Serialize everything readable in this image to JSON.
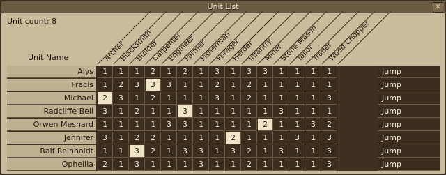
{
  "window": {
    "title": "Unit List",
    "close_label": "x"
  },
  "unit_count_label": "Unit count: 8",
  "unit_name_header": "Unit Name",
  "professions": [
    "Archer",
    "Blacksmith",
    "Builder",
    "Carpenter",
    "Engineer",
    "Farmer",
    "Fisherman",
    "Forager",
    "Herder",
    "Infantry",
    "Miner",
    "Stone Mason",
    "Tailor",
    "Trader",
    "Wood Chopper"
  ],
  "units": [
    {
      "name": "Alys",
      "values": [
        "1",
        "1",
        "1",
        "2",
        "1",
        "2",
        "1",
        "3",
        "1",
        "3",
        "3",
        "1",
        "1",
        "1",
        "1"
      ],
      "highlight": [],
      "action": "Jump"
    },
    {
      "name": "Fracis",
      "values": [
        "1",
        "2",
        "3",
        "3",
        "3",
        "1",
        "1",
        "2",
        "1",
        "2",
        "1",
        "1",
        "1",
        "1",
        "1"
      ],
      "highlight": [
        3
      ],
      "action": "Jump"
    },
    {
      "name": "Michael",
      "values": [
        "2",
        "3",
        "1",
        "2",
        "1",
        "1",
        "1",
        "3",
        "1",
        "2",
        "1",
        "1",
        "1",
        "1",
        "3"
      ],
      "highlight": [
        0
      ],
      "action": "Jump"
    },
    {
      "name": "Radcliffe Bell",
      "values": [
        "3",
        "1",
        "2",
        "1",
        "1",
        "3",
        "1",
        "1",
        "1",
        "1",
        "1",
        "3",
        "1",
        "1",
        "1"
      ],
      "highlight": [
        5
      ],
      "action": "Jump"
    },
    {
      "name": "Orwen Mesnard",
      "values": [
        "1",
        "1",
        "1",
        "1",
        "3",
        "3",
        "1",
        "1",
        "1",
        "1",
        "2",
        "1",
        "1",
        "3",
        "2"
      ],
      "highlight": [
        10
      ],
      "action": "Jump"
    },
    {
      "name": "Jennifer",
      "values": [
        "3",
        "1",
        "2",
        "2",
        "1",
        "1",
        "1",
        "1",
        "2",
        "1",
        "1",
        "1",
        "3",
        "1",
        "3"
      ],
      "highlight": [
        8
      ],
      "action": "Jump"
    },
    {
      "name": "Ralf Reinholdt",
      "values": [
        "1",
        "1",
        "3",
        "2",
        "1",
        "3",
        "3",
        "1",
        "3",
        "2",
        "1",
        "3",
        "1",
        "1",
        "3"
      ],
      "highlight": [
        2
      ],
      "action": "Jump"
    },
    {
      "name": "Ophellia",
      "values": [
        "2",
        "1",
        "3",
        "1",
        "1",
        "1",
        "3",
        "1",
        "1",
        "2",
        "1",
        "1",
        "1",
        "1",
        "3"
      ],
      "highlight": [],
      "action": "Jump"
    }
  ]
}
